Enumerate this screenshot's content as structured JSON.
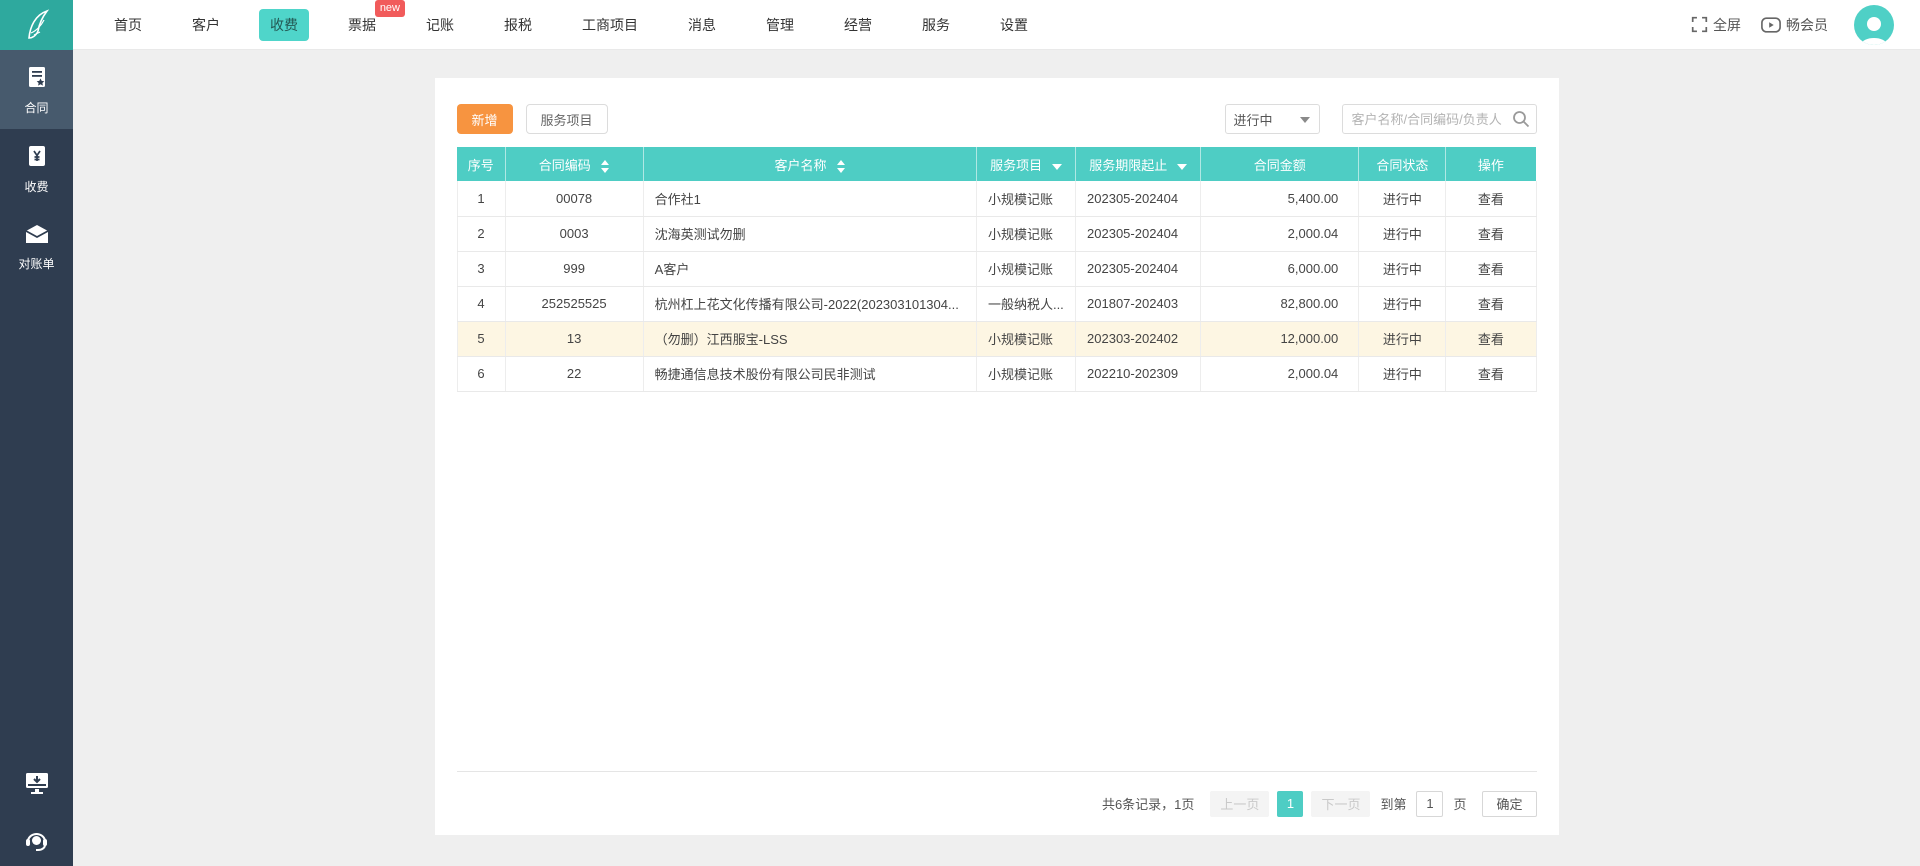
{
  "top_nav": {
    "items": [
      {
        "label": "首页",
        "active": false
      },
      {
        "label": "客户",
        "active": false
      },
      {
        "label": "收费",
        "active": true
      },
      {
        "label": "票据",
        "active": false,
        "badge": "new"
      },
      {
        "label": "记账",
        "active": false
      },
      {
        "label": "报税",
        "active": false
      },
      {
        "label": "工商项目",
        "active": false
      },
      {
        "label": "消息",
        "active": false
      },
      {
        "label": "管理",
        "active": false
      },
      {
        "label": "经营",
        "active": false
      },
      {
        "label": "服务",
        "active": false
      },
      {
        "label": "设置",
        "active": false
      }
    ],
    "fullscreen_label": "全屏",
    "member_label": "畅会员"
  },
  "sidebar": {
    "items": [
      {
        "label": "合同",
        "icon": "contract-icon",
        "active": true
      },
      {
        "label": "收费",
        "icon": "fee-icon",
        "active": false
      },
      {
        "label": "对账单",
        "icon": "statement-icon",
        "active": false
      }
    ]
  },
  "toolbar": {
    "add_label": "新增",
    "service_items_label": "服务项目",
    "status_filter_value": "进行中",
    "search_placeholder": "客户名称/合同编码/负责人"
  },
  "table": {
    "columns": [
      {
        "label": "序号"
      },
      {
        "label": "合同编码",
        "sort_both": true
      },
      {
        "label": "客户名称",
        "sort_both": true
      },
      {
        "label": "服务项目",
        "filter": true
      },
      {
        "label": "服务期限起止",
        "filter": true
      },
      {
        "label": "合同金额"
      },
      {
        "label": "合同状态"
      },
      {
        "label": "操作"
      }
    ],
    "rows": [
      {
        "seq": "1",
        "code": "00078",
        "customer": "合作社1",
        "service": "小规模记账",
        "period": "202305-202404",
        "amount": "5,400.00",
        "status": "进行中",
        "action": "查看",
        "highlight": false
      },
      {
        "seq": "2",
        "code": "0003",
        "customer": "沈海英测试勿删",
        "service": "小规模记账",
        "period": "202305-202404",
        "amount": "2,000.04",
        "status": "进行中",
        "action": "查看",
        "highlight": false
      },
      {
        "seq": "3",
        "code": "999",
        "customer": "A客户",
        "service": "小规模记账",
        "period": "202305-202404",
        "amount": "6,000.00",
        "status": "进行中",
        "action": "查看",
        "highlight": false
      },
      {
        "seq": "4",
        "code": "252525525",
        "customer": "杭州杠上花文化传播有限公司-2022(202303101304...",
        "service": "一般纳税人...",
        "period": "201807-202403",
        "amount": "82,800.00",
        "status": "进行中",
        "action": "查看",
        "highlight": false
      },
      {
        "seq": "5",
        "code": "13",
        "customer": "（勿删）江西服宝-LSS",
        "service": "小规模记账",
        "period": "202303-202402",
        "amount": "12,000.00",
        "status": "进行中",
        "action": "查看",
        "highlight": true
      },
      {
        "seq": "6",
        "code": "22",
        "customer": "畅捷通信息技术股份有限公司民非测试",
        "service": "小规模记账",
        "period": "202210-202309",
        "amount": "2,000.04",
        "status": "进行中",
        "action": "查看",
        "highlight": false
      }
    ]
  },
  "pagination": {
    "summary": "共6条记录，1页",
    "prev_label": "上一页",
    "current_page": "1",
    "next_label": "下一页",
    "goto_prefix": "到第",
    "goto_value": "1",
    "goto_suffix": "页",
    "confirm_label": "确定"
  },
  "colors": {
    "accent_teal": "#4ecdc4",
    "logo_teal": "#2ea99e",
    "sidebar_dark": "#2f3d50",
    "button_orange": "#f79440",
    "badge_red": "#f15b5b",
    "row_highlight": "#fdf6e3"
  }
}
